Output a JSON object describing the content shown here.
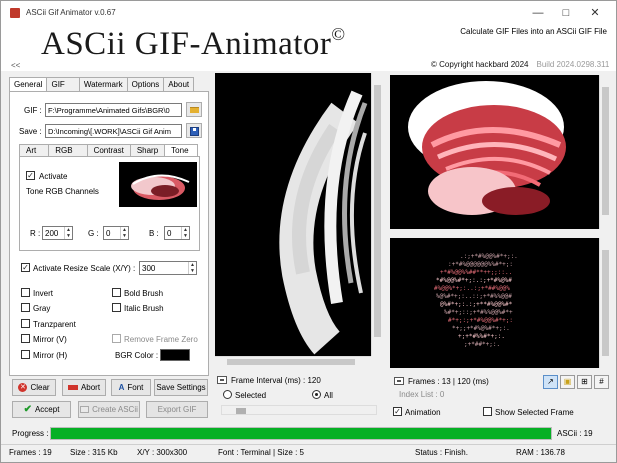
{
  "window": {
    "title": "ASCii Gif Animator v.0.67"
  },
  "header": {
    "logo": "ASCii GIF-Animator",
    "logo_mark": "©",
    "tagline": "Calculate GIF Files into an ASCii GIF File",
    "copyright": "© Copyright hackbard 2024",
    "build": "Build 2024.0298.311",
    "collapse": "<<"
  },
  "main_tabs": [
    "General",
    "GIF",
    "Watermark",
    "Options",
    "About"
  ],
  "general": {
    "gif_label": "GIF :",
    "gif_path": "F:\\Programme\\Animated Gifs\\BGR\\0",
    "save_label": "Save :",
    "save_path": "D:\\Incoming\\[.WORK]\\ASCii Gif Anim"
  },
  "sub_tabs": [
    "Art",
    "RGB",
    "Contrast",
    "Sharp",
    "Tone"
  ],
  "tone": {
    "activate_label": "Activate",
    "activate_checked": true,
    "channels_label": "Tone RGB Channels",
    "r_label": "R :",
    "r_value": "200",
    "g_label": "G :",
    "g_value": "0",
    "b_label": "B :",
    "b_value": "0"
  },
  "resize": {
    "label": "Activate Resize Scale (X/Y) :",
    "checked": true,
    "value": "300"
  },
  "options": {
    "invert": "Invert",
    "bold_brush": "Bold Brush",
    "gray": "Gray",
    "italic_brush": "Italic Brush",
    "tranzparent": "Tranzparent",
    "mirror_v": "Mirror (V)",
    "remove_frame_zero": "Remove Frame Zero",
    "mirror_h": "Mirror (H)",
    "bgr_color_label": "BGR Color :",
    "bgr_color": "#000000"
  },
  "buttons": {
    "clear": "Clear",
    "abort": "Abort",
    "font": "Font",
    "save_settings": "Save Settings",
    "accept": "Accept",
    "create_ascii": "Create ASCii",
    "export_gif": "Export GIF"
  },
  "frame_interval": {
    "label": "Frame Interval (ms) : 120",
    "selected_label": "Selected",
    "all_label": "All",
    "all_selected": true,
    "slider_value": 0.1
  },
  "right_panel": {
    "frames_label": "Frames : 13 | 120 (ms)",
    "index_list_label": "Index List : 0",
    "animation_label": "Animation",
    "animation_checked": true,
    "show_selected_label": "Show Selected Frame",
    "show_selected_checked": false
  },
  "progress": {
    "label": "Progress :",
    "value": 1.0,
    "ascii_label": "ASCii : 19"
  },
  "status": {
    "frames": "Frames :  19",
    "size": "Size :    315 Kb",
    "xy": "X/Y :    300x300",
    "font": "Font :  Terminal  |  Size :  5",
    "status": "Status :   Finish.",
    "ram": "RAM :    136.78"
  },
  "colors": {
    "accent": "#06b025",
    "tone_red": "#c83c46"
  }
}
